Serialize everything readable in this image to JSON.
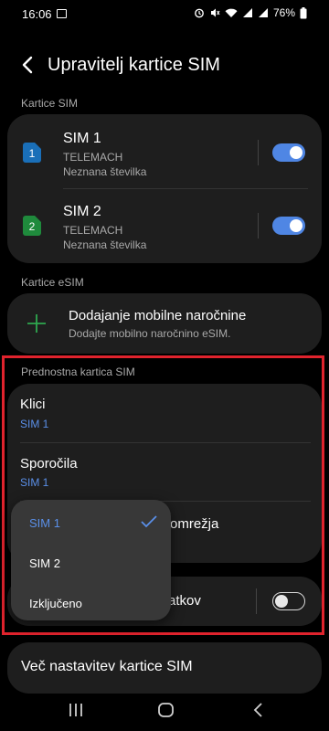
{
  "status_bar": {
    "time": "16:06",
    "battery": "76%"
  },
  "header": {
    "title": "Upravitelj kartice SIM"
  },
  "sections": {
    "sim_cards": "Kartice SIM",
    "esim_cards": "Kartice eSIM",
    "preferred": "Prednostna kartica SIM"
  },
  "sims": [
    {
      "name": "SIM 1",
      "carrier": "TELEMACH",
      "number": "Neznana številka",
      "badge": "1",
      "badge_color": "#1a6fb8",
      "enabled": true
    },
    {
      "name": "SIM 2",
      "carrier": "TELEMACH",
      "number": "Neznana številka",
      "badge": "2",
      "badge_color": "#1f8a3c",
      "enabled": true
    }
  ],
  "esim": {
    "title": "Dodajanje mobilne naročnine",
    "subtitle": "Dodajte mobilno naročnino eSIM.",
    "icon": "plus-icon"
  },
  "preferred": {
    "calls": {
      "title": "Klici",
      "value": "SIM 1"
    },
    "messages": {
      "title": "Sporočila",
      "value": "SIM 1"
    },
    "network_partial": "omrežja",
    "data_partial": "atkov",
    "data_enabled": false
  },
  "dropdown": {
    "options": [
      {
        "label": "SIM 1",
        "selected": true
      },
      {
        "label": "SIM 2",
        "selected": false
      },
      {
        "label": "Izključeno",
        "selected": false
      }
    ]
  },
  "more_settings": {
    "label": "Več nastavitev kartice SIM"
  },
  "colors": {
    "accent": "#4f86e4",
    "highlight_border": "#e0232d",
    "card_bg": "#1e1e1e"
  }
}
